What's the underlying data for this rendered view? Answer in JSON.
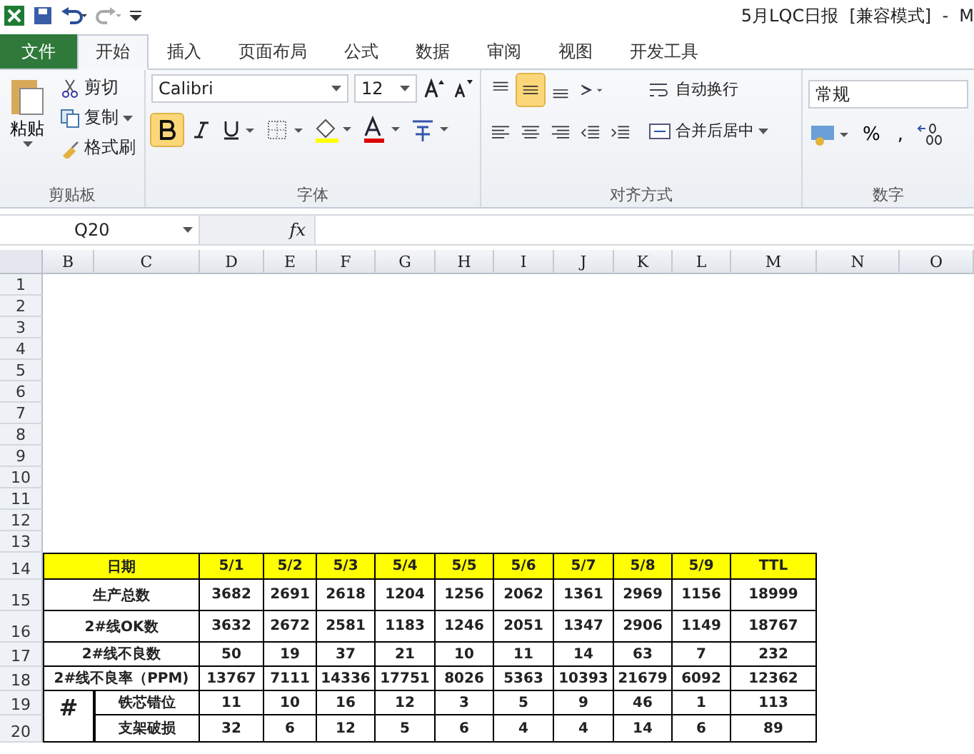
{
  "window": {
    "title": "5月LQC日报  [兼容模式]  -  M"
  },
  "tabs": [
    {
      "label": "文件",
      "kind": "file",
      "selected": false
    },
    {
      "label": "开始",
      "kind": "tab",
      "selected": true
    },
    {
      "label": "插入",
      "kind": "tab",
      "selected": false
    },
    {
      "label": "页面布局",
      "kind": "tab",
      "selected": false
    },
    {
      "label": "公式",
      "kind": "tab",
      "selected": false
    },
    {
      "label": "数据",
      "kind": "tab",
      "selected": false
    },
    {
      "label": "审阅",
      "kind": "tab",
      "selected": false
    },
    {
      "label": "视图",
      "kind": "tab",
      "selected": false
    },
    {
      "label": "开发工具",
      "kind": "tab",
      "selected": false
    }
  ],
  "ribbon": {
    "clipboard": {
      "paste": "粘贴",
      "cut": "剪切",
      "copy": "复制",
      "format_painter": "格式刷",
      "group": "剪贴板"
    },
    "font": {
      "family": "Calibri",
      "size": "12",
      "bold_on": true,
      "group": "字体"
    },
    "alignment": {
      "middle_on": true,
      "wrap": "自动换行",
      "merge": "合并后居中",
      "group": "对齐方式"
    },
    "number": {
      "format": "常规",
      "percent": "%",
      "comma": ",",
      "group": "数字"
    }
  },
  "formula_bar": {
    "name_box": "Q20",
    "fx": "fx"
  },
  "columns": [
    "B",
    "C",
    "D",
    "E",
    "F",
    "G",
    "H",
    "I",
    "J",
    "K",
    "L",
    "M",
    "N",
    "O"
  ],
  "row_numbers": [
    "1",
    "2",
    "3",
    "4",
    "5",
    "6",
    "7",
    "8",
    "9",
    "10",
    "11",
    "12",
    "13",
    "14",
    "15",
    "16",
    "17",
    "18",
    "19",
    "20"
  ],
  "table": {
    "header": {
      "label": "日期",
      "values": [
        "5/1",
        "5/2",
        "5/3",
        "5/4",
        "5/5",
        "5/6",
        "5/7",
        "5/8",
        "5/9",
        "TTL"
      ]
    },
    "rows": [
      {
        "label": "生产总数",
        "values": [
          "3682",
          "2691",
          "2618",
          "1204",
          "1256",
          "2062",
          "1361",
          "2969",
          "1156",
          "18999"
        ]
      },
      {
        "label": "2#线OK数",
        "values": [
          "3632",
          "2672",
          "2581",
          "1183",
          "1246",
          "2051",
          "1347",
          "2906",
          "1149",
          "18767"
        ]
      },
      {
        "label": "2#线不良数",
        "values": [
          "50",
          "19",
          "37",
          "21",
          "10",
          "11",
          "14",
          "63",
          "7",
          "232"
        ]
      },
      {
        "label": "2#线不良率（PPM)",
        "values": [
          "13767",
          "7111",
          "14336",
          "17751",
          "8026",
          "5363",
          "10393",
          "21679",
          "6092",
          "12362"
        ]
      }
    ],
    "group": {
      "label": "#",
      "rows": [
        {
          "label": "铁芯错位",
          "values": [
            "11",
            "10",
            "16",
            "12",
            "3",
            "5",
            "9",
            "46",
            "1",
            "113"
          ]
        },
        {
          "label": "支架破损",
          "values": [
            "32",
            "6",
            "12",
            "5",
            "6",
            "4",
            "4",
            "14",
            "6",
            "89"
          ]
        }
      ]
    }
  }
}
